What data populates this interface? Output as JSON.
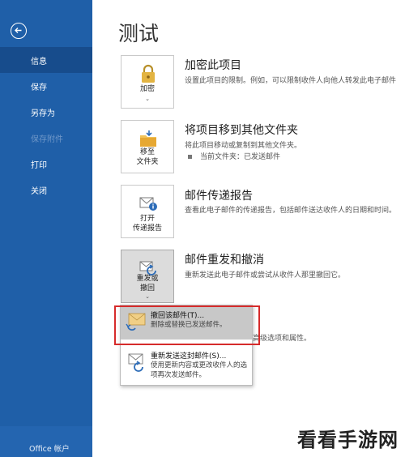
{
  "sidebar": {
    "back_icon": "arrow-left-icon",
    "items": [
      {
        "label": "信息",
        "active": true,
        "enabled": true
      },
      {
        "label": "保存",
        "active": false,
        "enabled": true
      },
      {
        "label": "另存为",
        "active": false,
        "enabled": true
      },
      {
        "label": "保存附件",
        "active": false,
        "enabled": false
      },
      {
        "label": "打印",
        "active": false,
        "enabled": true
      },
      {
        "label": "关闭",
        "active": false,
        "enabled": true
      }
    ],
    "footer_label": "Office 帐户",
    "bg_color": "#1f5fa8"
  },
  "main": {
    "title": "测试",
    "sections": [
      {
        "tile_line1": "加密",
        "tile_icon": "lock-icon",
        "title": "加密此项目",
        "desc": "设置此项目的限制。例如，可以限制收件人向他人转发此电子邮件"
      },
      {
        "tile_line1": "移至",
        "tile_line2": "文件夹",
        "tile_icon": "move-folder-icon",
        "title": "将项目移到其他文件夹",
        "desc": "将此项目移动或复制到其他文件夹。",
        "bullet": "当前文件夹：已发送邮件"
      },
      {
        "tile_line1": "打开",
        "tile_line2": "传递报告",
        "tile_icon": "delivery-report-icon",
        "title": "邮件传递报告",
        "desc": "查看此电子邮件的传递报告，包括邮件送达收件人的日期和时间。"
      },
      {
        "tile_line1": "重发或",
        "tile_line2": "撤回",
        "tile_icon": "resend-recall-icon",
        "title": "邮件重发和撤消",
        "desc": "重新发送此电子邮件或尝试从收件人那里撤回它。"
      }
    ],
    "behind_text": "高级选项和属性。"
  },
  "dropdown": {
    "items": [
      {
        "title": "撤回该邮件(T)...",
        "desc": "删除或替换已发送邮件。",
        "icon": "recall-message-icon",
        "highlighted": true
      },
      {
        "title": "重新发送这封邮件(S)...",
        "desc": "使用更新内容或更改收件人的选项再次发送邮件。",
        "icon": "resend-message-icon",
        "highlighted": false
      }
    ]
  },
  "watermark": "看看手游网"
}
